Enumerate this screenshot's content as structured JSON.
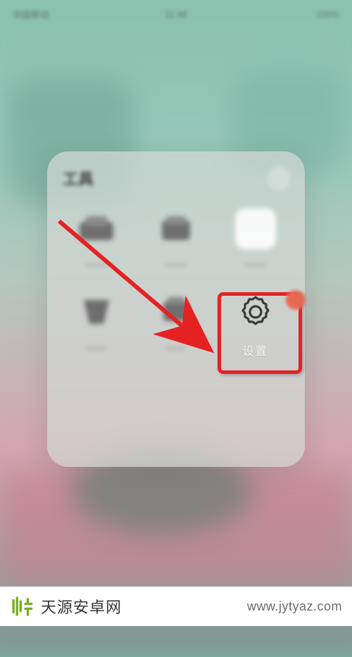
{
  "status_bar": {
    "left": "中国移动",
    "center": "11:48",
    "right": "100%"
  },
  "folder": {
    "title": "工具",
    "items": [
      {
        "label": "——",
        "icon": "generic-icon"
      },
      {
        "label": "——",
        "icon": "generic-icon"
      },
      {
        "label": "——",
        "icon": "rounded-app-icon"
      },
      {
        "label": "——",
        "icon": "generic-icon"
      },
      {
        "label": "——",
        "icon": "generic-icon"
      },
      {
        "label": "设置",
        "icon": "gear-icon"
      }
    ]
  },
  "annotation": {
    "highlight_color": "#e52222",
    "arrow_color": "#e52222"
  },
  "watermark": {
    "site_name": "天源安卓网",
    "site_url": "www.jytyaz.com",
    "brand_color": "#7aae1f"
  }
}
